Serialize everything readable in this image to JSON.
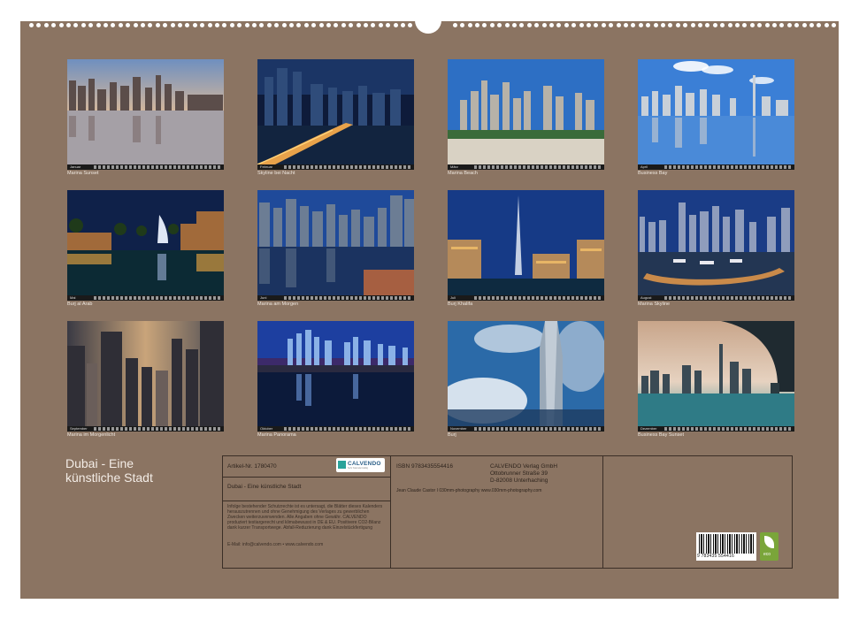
{
  "calendar": {
    "title": "Dubai - Eine künstliche Stadt",
    "title_line1": "Dubai - Eine",
    "title_line2": "künstliche Stadt"
  },
  "months": [
    {
      "caption": "Marina Sunset",
      "month": "Januar"
    },
    {
      "caption": "Skyline bei Nacht",
      "month": "Februar"
    },
    {
      "caption": "Marina Beach",
      "month": "März"
    },
    {
      "caption": "Business Bay",
      "month": "April"
    },
    {
      "caption": "Burj al Arab",
      "month": "Mai"
    },
    {
      "caption": "Marina am Morgen",
      "month": "Juni"
    },
    {
      "caption": "Burj Khalifa",
      "month": "Juli"
    },
    {
      "caption": "Marina Skyline",
      "month": "August"
    },
    {
      "caption": "Marina im Morgenlicht",
      "month": "September"
    },
    {
      "caption": "Marina Panorama",
      "month": "Oktober"
    },
    {
      "caption": "Burj",
      "month": "November"
    },
    {
      "caption": "Business Bay Sunset",
      "month": "Dezember"
    }
  ],
  "info": {
    "article": "Artikel-Nr. 1780470",
    "calvendo_logo": "CALVENDO",
    "calvendo_sub": "Sehr Kalendermäßig",
    "subtitle": "Dubai - Eine künstliche Stadt",
    "legal": "Infolge bestehender Schutzrechte ist es untersagt, die Blätter dieses Kalenders herauszutrennen und ohne Genehmigung des Verlages zu gewerblichen Zwecken weiterzuverwenden. Alle Angaben ohne Gewähr. CALVENDO produziert testiargerecht und klimabewusst in DE & EU. Positivere CO2-Bilanz dank kurzer Transportwege. Abfall-Reduzierung dank Einzelstückfertigung",
    "email": "E-Mail: info@calvendo.com • www.calvendo.com",
    "isbn": "ISBN 9783435554416",
    "publisher_1": "CALVENDO Verlag GmbH",
    "publisher_2": "Ottobrunner Straße 39",
    "publisher_3": "D-82008 Unterhaching",
    "author": "Jean Claude Castor I 030mm-photography www.030mm-photography.com",
    "barcode_number": "9 783435 554416",
    "eco_label": "eco"
  }
}
